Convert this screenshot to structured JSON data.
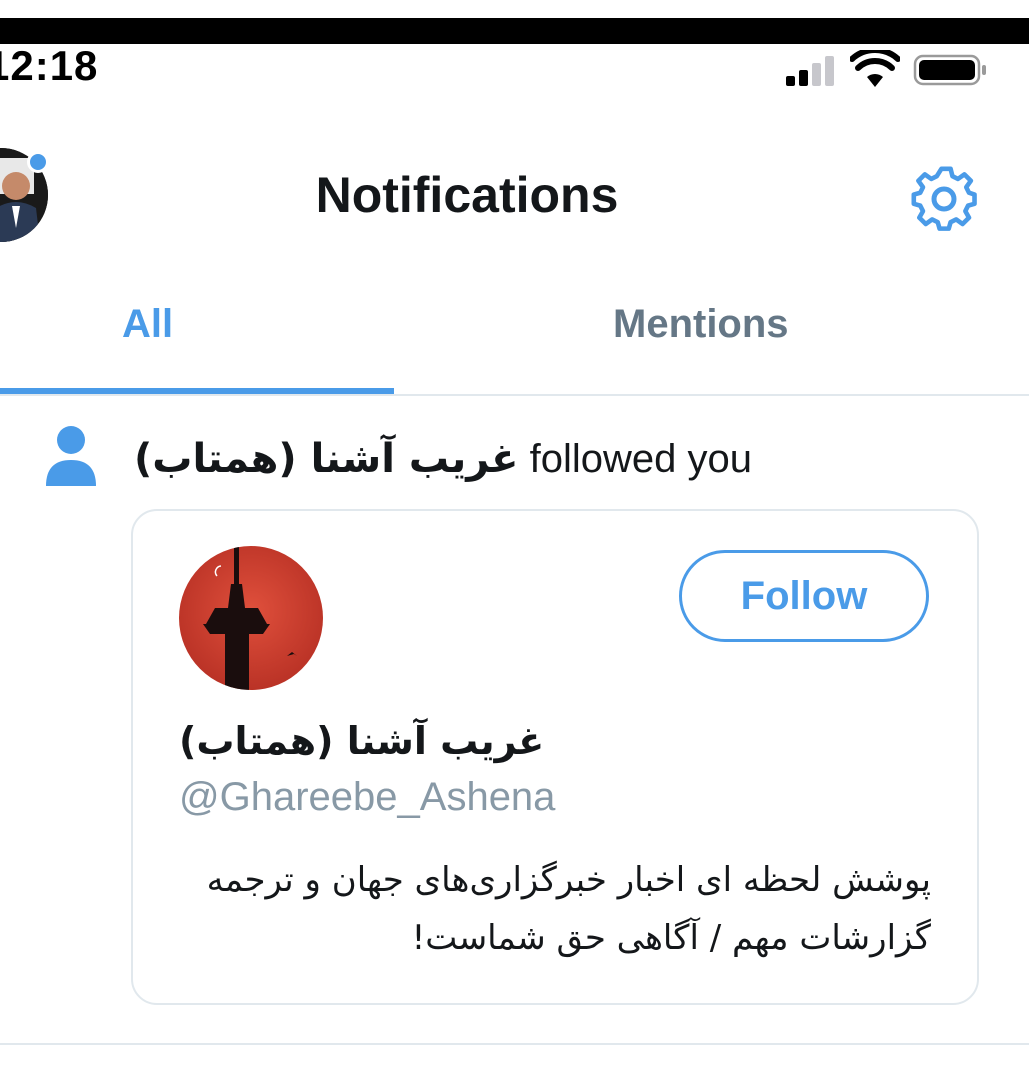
{
  "status_bar": {
    "time": "12:18",
    "signal_icon": "cellular-signal-icon",
    "wifi_icon": "wifi-icon",
    "battery_icon": "battery-icon"
  },
  "header": {
    "title": "Notifications",
    "settings_icon": "gear-icon"
  },
  "tabs": [
    {
      "label": "All",
      "active": true
    },
    {
      "label": "Mentions",
      "active": false
    }
  ],
  "notification": {
    "icon": "person-icon",
    "user_name": "غریب آشنا (همتاب)",
    "action_text": " followed you",
    "card": {
      "name": "غریب آشنا (همتاب)",
      "handle": "@Ghareebe_Ashena",
      "bio": "پوشش لحظه ای اخبار خبرگزاری‌های جهان و ترجمه گزارشات مهم / آگاهی حق شماست!",
      "follow_label": "Follow"
    }
  },
  "colors": {
    "accent": "#4a9be8",
    "text": "#14171a",
    "muted": "#657786",
    "handle": "#8899a6",
    "divider": "#e1e8ed"
  }
}
